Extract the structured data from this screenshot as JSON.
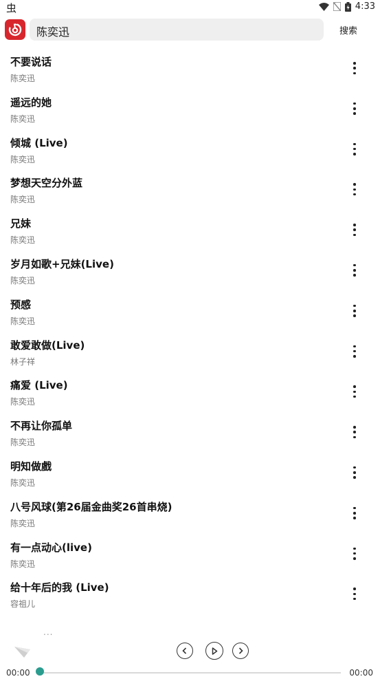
{
  "status_bar": {
    "carrier_glyph": "虫",
    "time": "4:33",
    "icons": [
      "wifi-icon",
      "no-sim-icon",
      "battery-icon"
    ]
  },
  "header": {
    "logo_icon": "netease-music-logo",
    "search_value": "陈奕迅",
    "search_button": "搜索"
  },
  "songs": [
    {
      "title": "不要说话",
      "artist": "陈奕迅"
    },
    {
      "title": "遥远的她",
      "artist": "陈奕迅"
    },
    {
      "title": "倾城 (Live)",
      "artist": "陈奕迅"
    },
    {
      "title": "梦想天空分外蓝",
      "artist": "陈奕迅"
    },
    {
      "title": "兄妹",
      "artist": "陈奕迅"
    },
    {
      "title": "岁月如歌+兄妹(Live)",
      "artist": "陈奕迅"
    },
    {
      "title": "预感",
      "artist": "陈奕迅"
    },
    {
      "title": "敢爱敢做(Live)",
      "artist": "林子祥"
    },
    {
      "title": "痛爱 (Live)",
      "artist": "陈奕迅"
    },
    {
      "title": "不再让你孤单",
      "artist": "陈奕迅"
    },
    {
      "title": "明知做戲",
      "artist": "陈奕迅"
    },
    {
      "title": "八号风球(第26届金曲奖26首串烧)",
      "artist": "陈奕迅"
    },
    {
      "title": "有一点动心(live)",
      "artist": "陈奕迅"
    },
    {
      "title": "给十年后的我 (Live)",
      "artist": "容祖儿"
    }
  ],
  "player": {
    "now_playing_placeholder": "...",
    "time_elapsed": "00:00",
    "time_total": "00:00",
    "progress": 0,
    "accent_color": "#2a9d8f",
    "controls": [
      "previous-icon",
      "play-icon",
      "next-icon"
    ]
  },
  "colors": {
    "brand_red": "#d8262d",
    "search_bg": "#efefef"
  }
}
